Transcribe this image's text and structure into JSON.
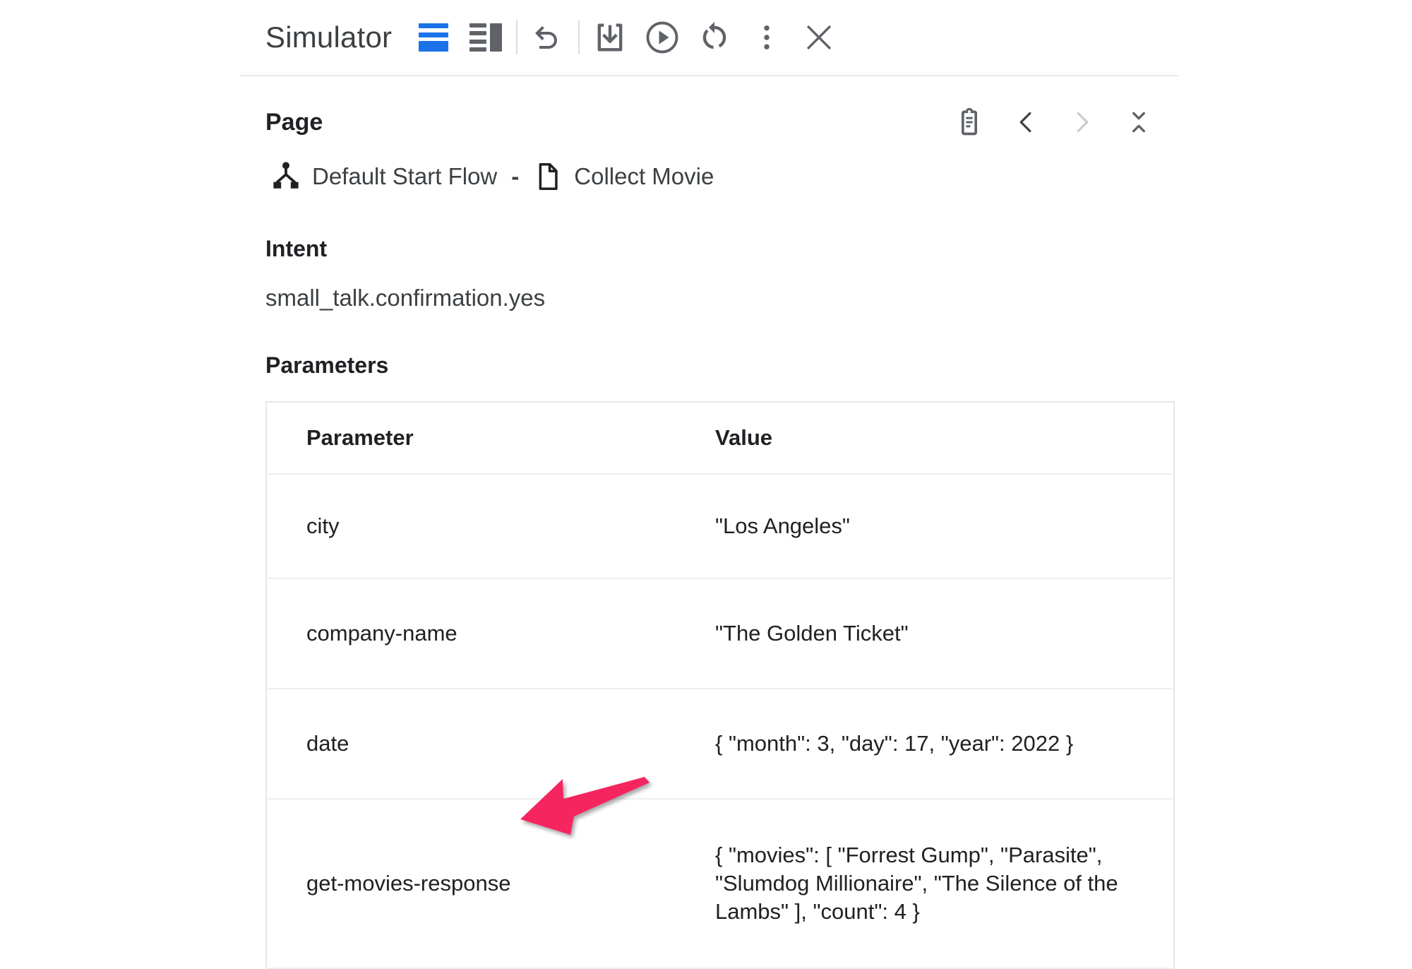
{
  "window": {
    "title": "Simulator",
    "accent_color": "#1a73e8",
    "icon_color": "#5f6368",
    "annotation_color": "#F5255F"
  },
  "toolbar": {
    "buttons": [
      {
        "name": "view-mode-rows",
        "icon": "rows-layout-icon",
        "active": true
      },
      {
        "name": "view-mode-split",
        "icon": "split-layout-icon",
        "active": false
      },
      {
        "name": "undo",
        "icon": "undo-icon",
        "active": false
      },
      {
        "name": "download",
        "icon": "download-icon",
        "active": false
      },
      {
        "name": "play",
        "icon": "play-circle-icon",
        "active": false
      },
      {
        "name": "restart",
        "icon": "restart-icon",
        "active": false
      },
      {
        "name": "more-options",
        "icon": "more-vert-icon",
        "active": false
      },
      {
        "name": "close",
        "icon": "close-icon",
        "active": false
      }
    ]
  },
  "page_section": {
    "label": "Page",
    "actions": [
      {
        "name": "copy-to-clipboard",
        "icon": "clipboard-icon"
      },
      {
        "name": "previous",
        "icon": "chevron-left-icon"
      },
      {
        "name": "next",
        "icon": "chevron-right-icon"
      },
      {
        "name": "collapse",
        "icon": "unfold-less-icon"
      }
    ],
    "flow_icon": "flow-branch-icon",
    "flow_name": "Default Start Flow",
    "separator": "-",
    "page_icon": "page-document-icon",
    "page_name": "Collect Movie"
  },
  "intent": {
    "label": "Intent",
    "value": "small_talk.confirmation.yes"
  },
  "parameters": {
    "label": "Parameters",
    "columns": [
      "Parameter",
      "Value"
    ],
    "rows": [
      {
        "parameter": "city",
        "value": "\"Los Angeles\""
      },
      {
        "parameter": "company-name",
        "value": "\"The Golden Ticket\""
      },
      {
        "parameter": "date",
        "value": "{ \"month\": 3, \"day\": 17, \"year\": 2022 }"
      },
      {
        "parameter": "get-movies-response",
        "value": "{ \"movies\": [ \"Forrest Gump\", \"Parasite\", \"Slumdog Millionaire\", \"The Silence of the Lambs\" ], \"count\": 4 }"
      }
    ]
  },
  "annotation": {
    "type": "arrow",
    "points_to": "get-movies-response",
    "color": "#F5255F"
  }
}
